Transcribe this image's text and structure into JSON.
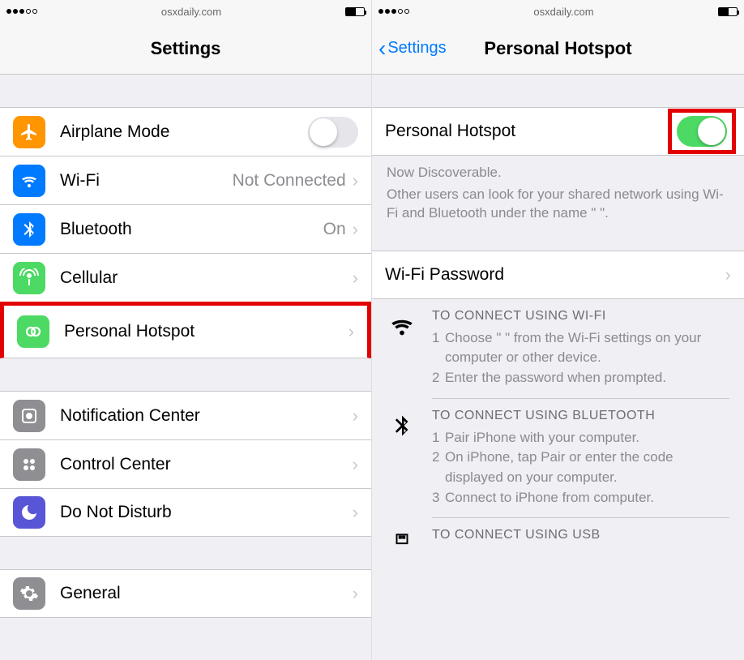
{
  "statusbar": {
    "url": "osxdaily.com"
  },
  "left": {
    "title": "Settings",
    "rows": {
      "airplane": {
        "label": "Airplane Mode"
      },
      "wifi": {
        "label": "Wi-Fi",
        "detail": "Not Connected"
      },
      "bluetooth": {
        "label": "Bluetooth",
        "detail": "On"
      },
      "cellular": {
        "label": "Cellular"
      },
      "hotspot": {
        "label": "Personal Hotspot"
      },
      "notification": {
        "label": "Notification Center"
      },
      "control": {
        "label": "Control Center"
      },
      "dnd": {
        "label": "Do Not Disturb"
      },
      "general": {
        "label": "General"
      }
    }
  },
  "right": {
    "back": "Settings",
    "title": "Personal Hotspot",
    "toggle": {
      "label": "Personal Hotspot",
      "on": true
    },
    "discover_head": "Now Discoverable.",
    "discover_body": "Other users can look for your shared network using Wi-Fi and Bluetooth under the name \"                         \".",
    "wifi_password": {
      "label": "Wi-Fi Password"
    },
    "instr_wifi": {
      "title": "TO CONNECT USING WI-FI",
      "l1": "Choose \"                         \" from the Wi-Fi settings on your computer or other device.",
      "l2": "Enter the password when prompted."
    },
    "instr_bt": {
      "title": "TO CONNECT USING BLUETOOTH",
      "l1": "Pair iPhone with your computer.",
      "l2": "On iPhone, tap Pair or enter the code displayed on your computer.",
      "l3": "Connect to iPhone from computer."
    },
    "instr_usb": {
      "title": "TO CONNECT USING USB"
    }
  }
}
